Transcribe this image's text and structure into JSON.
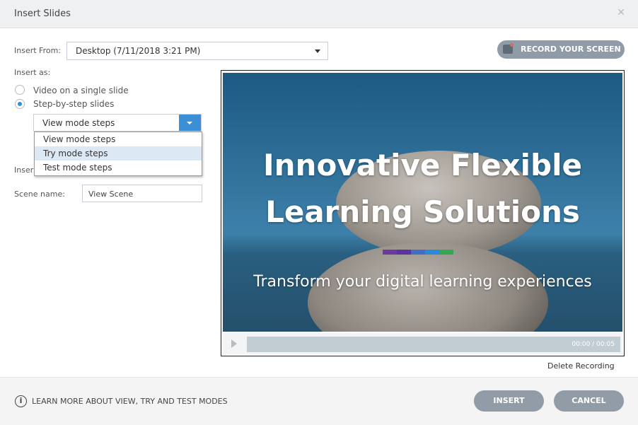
{
  "dialog": {
    "title": "Insert Slides",
    "close_icon": "close-icon"
  },
  "insert_from": {
    "label": "Insert From:",
    "value": "Desktop (7/11/2018 3:21 PM)"
  },
  "record_button": "RECORD YOUR SCREEN",
  "insert_as": {
    "label": "Insert as:",
    "options": [
      "Video on a single slide",
      "Step-by-step slides"
    ],
    "selected": 1
  },
  "steps_combo": {
    "value": "View mode steps",
    "options": [
      "View mode steps",
      "Try mode steps",
      "Test mode steps"
    ],
    "highlighted": 1
  },
  "insert_partial_label": "Inser",
  "scene": {
    "label": "Scene name:",
    "value": "View Scene"
  },
  "slide": {
    "title_line1": "Innovative Flexible",
    "title_line2": "Learning Solutions",
    "subtitle": "Transform your digital learning experiences",
    "bar_colors": [
      "#6a3aa0",
      "#5a33a0",
      "#3f6ec4",
      "#2a8ad8",
      "#33a852"
    ]
  },
  "player": {
    "time": "00:00 / 00:05",
    "progress": 0
  },
  "delete_recording": "Delete Recording",
  "footer": {
    "learn_more": "LEARN MORE ABOUT VIEW, TRY AND TEST MODES",
    "insert": "INSERT",
    "cancel": "CANCEL"
  }
}
